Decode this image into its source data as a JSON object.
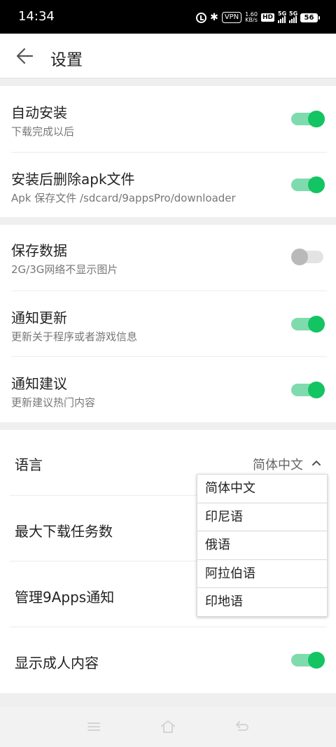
{
  "status_bar": {
    "time": "14:34",
    "vpn": "VPN",
    "speed_value": "1.60",
    "speed_unit": "KB/s",
    "hd": "HD",
    "sim1_network": "5G",
    "sim2_network": "5G",
    "battery": "56"
  },
  "toolbar": {
    "title": "设置",
    "back_icon": "arrow-left-icon"
  },
  "section1": {
    "auto_install": {
      "title": "自动安装",
      "subtitle": "下载完成以后",
      "enabled": true
    },
    "delete_apk": {
      "title": "安装后删除apk文件",
      "subtitle": "Apk 保存文件 /sdcard/9appsPro/downloader",
      "enabled": true
    }
  },
  "section2": {
    "save_data": {
      "title": "保存数据",
      "subtitle": "2G/3G网络不显示图片",
      "enabled": false
    },
    "notify_update": {
      "title": "通知更新",
      "subtitle": "更新关于程序或者游戏信息",
      "enabled": true
    },
    "notify_suggest": {
      "title": "通知建议",
      "subtitle": "更新建议热门内容",
      "enabled": true
    }
  },
  "section3": {
    "language": {
      "title": "语言",
      "value": "简体中文"
    },
    "max_downloads": {
      "title": "最大下载任务数"
    },
    "manage_notifications": {
      "title": "管理9Apps通知"
    },
    "adult_content": {
      "title": "显示成人内容",
      "enabled": true
    }
  },
  "language_dropdown": {
    "options": [
      "简体中文",
      "印尼语",
      "俄语",
      "阿拉伯语",
      "印地语"
    ]
  },
  "colors": {
    "toggle_on_track": "#7fdbad",
    "toggle_on_thumb": "#13c462",
    "toggle_off_track": "#e3e3e3",
    "toggle_off_thumb": "#b9b9b9",
    "page_background": "#efefef"
  },
  "nav_icons": [
    "menu-icon",
    "home-icon",
    "back-icon"
  ]
}
